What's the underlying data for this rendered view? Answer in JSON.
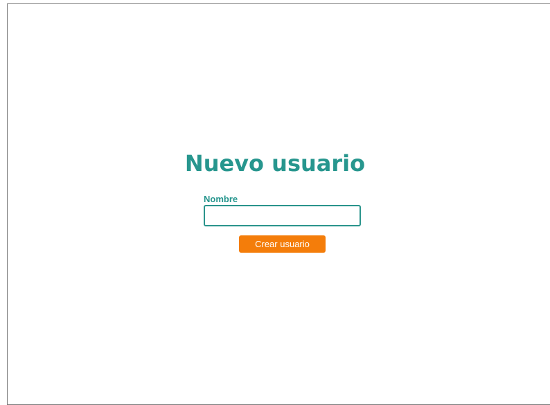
{
  "page": {
    "title": "Nuevo usuario"
  },
  "form": {
    "name_label": "Nombre",
    "name_value": "",
    "submit_label": "Crear usuario"
  },
  "colors": {
    "accent": "#27968e",
    "button": "#f47d0a",
    "button_text": "#ffffff",
    "background": "#ffffff"
  }
}
